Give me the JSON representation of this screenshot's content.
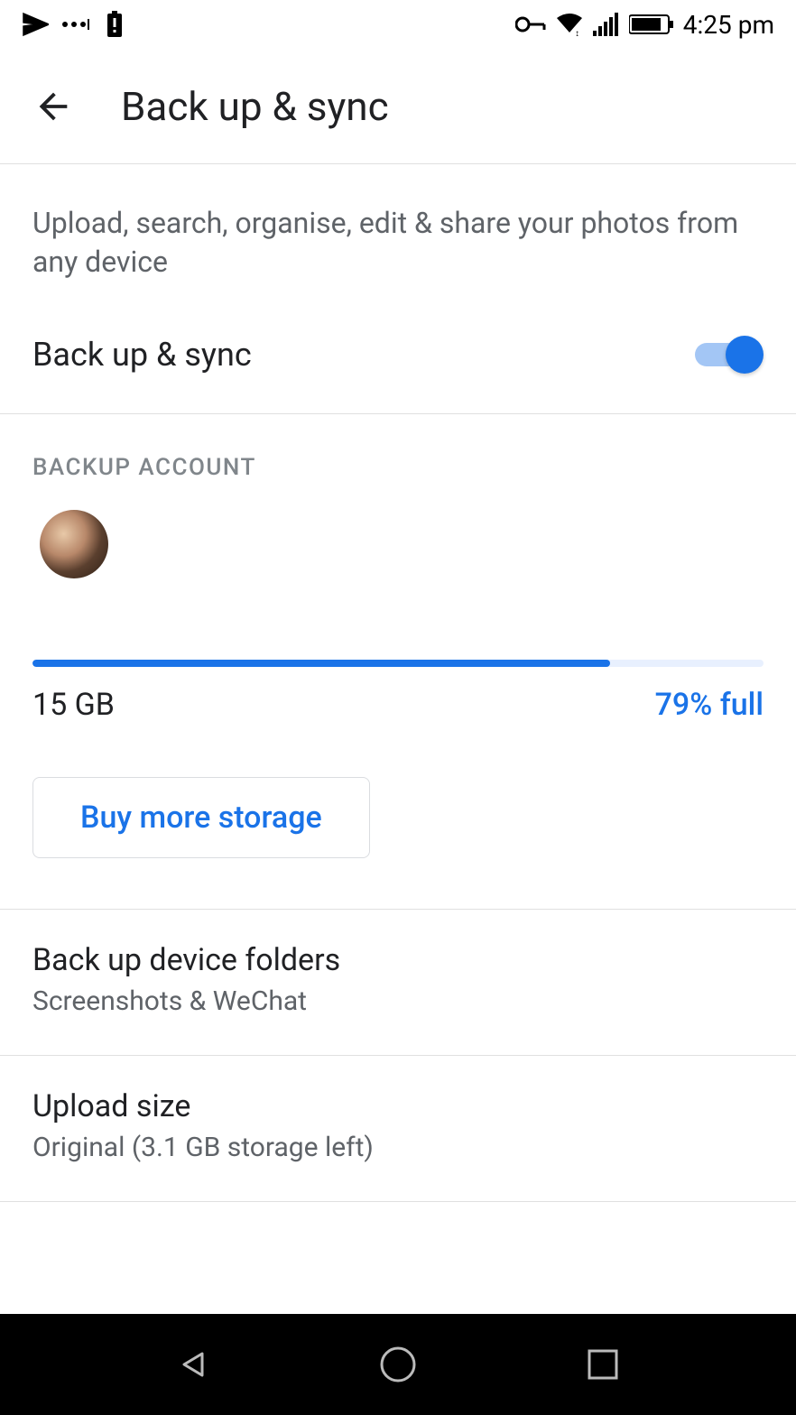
{
  "status_bar": {
    "time": "4:25 pm"
  },
  "header": {
    "title": "Back up & sync"
  },
  "description": "Upload, search, organise, edit & share your photos from any device",
  "backup_toggle": {
    "label": "Back up & sync",
    "enabled": true
  },
  "backup_account": {
    "section_label": "BACKUP ACCOUNT"
  },
  "storage": {
    "total": "15 GB",
    "percent_full": "79% full",
    "percent_value": 79,
    "buy_button_label": "Buy more storage"
  },
  "settings": [
    {
      "title": "Back up device folders",
      "subtitle": "Screenshots & WeChat"
    },
    {
      "title": "Upload size",
      "subtitle": "Original (3.1 GB storage left)"
    }
  ]
}
